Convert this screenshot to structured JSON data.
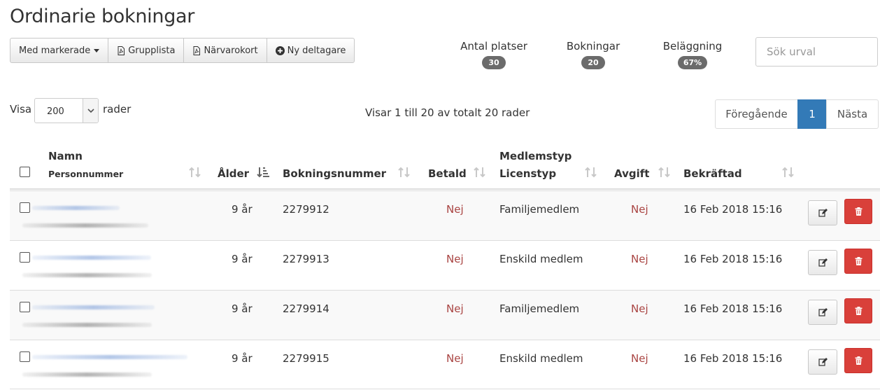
{
  "page": {
    "title": "Ordinarie bokningar"
  },
  "toolbar": {
    "marked_label": "Med markerade",
    "grouplist_label": "Grupplista",
    "attendance_label": "Närvarokort",
    "new_participant_label": "Ny deltagare"
  },
  "stats": [
    {
      "label": "Antal platser",
      "value": "30"
    },
    {
      "label": "Bokningar",
      "value": "20"
    },
    {
      "label": "Beläggning",
      "value": "67%"
    }
  ],
  "search": {
    "placeholder": "Sök urval",
    "value": ""
  },
  "length": {
    "prefix": "Visa",
    "value": "200",
    "suffix": "rader"
  },
  "info": "Visar 1 till 20 av totalt 20 rader",
  "pagination": {
    "prev": "Föregående",
    "current": "1",
    "next": "Nästa"
  },
  "columns": {
    "name": "Namn",
    "personnummer": "Personnummer",
    "age": "Ålder",
    "booking_number": "Bokningsnummer",
    "paid": "Betald",
    "member_type": "Medlemstyp",
    "license_type": "Licenstyp",
    "fee": "Avgift",
    "confirmed": "Bekräftad"
  },
  "rows": [
    {
      "age": "9 år",
      "booking_number": "2279912",
      "paid": "Nej",
      "member_type": "Familjemedlem",
      "fee": "Nej",
      "confirmed": "16 Feb 2018 15:16"
    },
    {
      "age": "9 år",
      "booking_number": "2279913",
      "paid": "Nej",
      "member_type": "Enskild medlem",
      "fee": "Nej",
      "confirmed": "16 Feb 2018 15:16"
    },
    {
      "age": "9 år",
      "booking_number": "2279914",
      "paid": "Nej",
      "member_type": "Familjemedlem",
      "fee": "Nej",
      "confirmed": "16 Feb 2018 15:16"
    },
    {
      "age": "9 år",
      "booking_number": "2279915",
      "paid": "Nej",
      "member_type": "Enskild medlem",
      "fee": "Nej",
      "confirmed": "16 Feb 2018 15:16"
    }
  ],
  "colors": {
    "primary": "#337ab7",
    "danger": "#d9403a",
    "no_text": "#a94442",
    "badge": "#6b6b6b"
  }
}
